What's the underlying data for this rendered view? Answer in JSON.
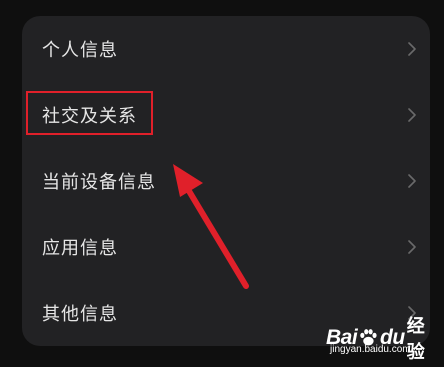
{
  "menu": {
    "items": [
      {
        "label": "个人信息",
        "chevron": "chevron-right-icon"
      },
      {
        "label": "社交及关系",
        "chevron": "chevron-right-icon"
      },
      {
        "label": "当前设备信息",
        "chevron": "chevron-right-icon"
      },
      {
        "label": "应用信息",
        "chevron": "chevron-right-icon"
      },
      {
        "label": "其他信息",
        "chevron": "chevron-right-icon"
      }
    ]
  },
  "annotation": {
    "highlight_color": "#e0202a",
    "arrow_color": "#e0202a",
    "highlighted_item": "社交及关系"
  },
  "watermark": {
    "brand_left": "Bai",
    "brand_right": "du",
    "brand_suffix": "经验",
    "url": "jingyan.baidu.com"
  },
  "colors": {
    "background": "#0f0f0f",
    "panel": "#222224",
    "text": "#e6e6e6",
    "chevron": "#6a6a6a"
  }
}
